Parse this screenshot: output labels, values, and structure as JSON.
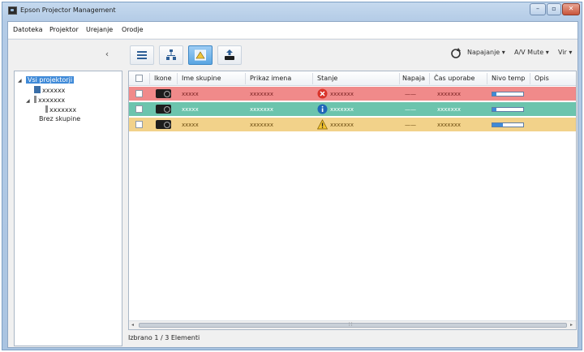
{
  "window": {
    "title": "Epson Projector Management"
  },
  "window_buttons": {
    "minimize": "–",
    "maximize": "▫",
    "close": "✕"
  },
  "menu": [
    "Datoteka",
    "Projektor",
    "Urejanje",
    "Orodje"
  ],
  "toolbar": {
    "collapse": "‹",
    "tabs": [
      {
        "icon": "list-view-icon",
        "active": false
      },
      {
        "icon": "network-view-icon",
        "active": false
      },
      {
        "icon": "warning-view-icon",
        "active": true
      },
      {
        "icon": "upload-projector-icon",
        "active": false
      }
    ],
    "refresh_icon": "refresh-icon",
    "power": "Napajanje ▾",
    "av_mute": "A/V Mute ▾",
    "source": "Vir ▾"
  },
  "tree": {
    "root_toggle": "◢",
    "root": "Vsi projektorji",
    "group1": "xxxxxx",
    "group2_toggle": "◢",
    "group2": "xxxxxxx",
    "group2_child": "xxxxxxx",
    "no_group": "Brez skupine"
  },
  "table": {
    "headers": [
      "Ikone",
      "Ime skupine",
      "Prikaz imena",
      "Stanje",
      "Napaja",
      "Čas uporabe",
      "Nivo temp",
      "Opis"
    ],
    "rows": [
      {
        "group": "xxxxx",
        "display": "xxxxxxx",
        "status": "xxxxxxx",
        "status_icon": "error-icon",
        "power": "——",
        "usage": "xxxxxxx",
        "temp_level": 0.12,
        "bg": "#f08a8a",
        "text_color": "#7a2222"
      },
      {
        "group": "xxxxx",
        "display": "xxxxxxx",
        "status": "xxxxxxx",
        "status_icon": "info-icon",
        "power": "——",
        "usage": "xxxxxxx",
        "temp_level": 0.12,
        "bg": "#6cc4ad",
        "text_color": "#ffffff"
      },
      {
        "group": "xxxxx",
        "display": "xxxxxxx",
        "status": "xxxxxxx",
        "status_icon": "warning-icon",
        "power": "——",
        "usage": "xxxxxxx",
        "temp_level": 0.35,
        "bg": "#f2d28a",
        "text_color": "#6a4b10"
      }
    ],
    "scroll_left": "◂",
    "scroll_right": "▸",
    "scroll_grip": "∷"
  },
  "status": {
    "text": "Izbrano 1 / 3 Elementi"
  },
  "colors": {
    "accent": "#3f8ad8",
    "error_row": "#f08a8a",
    "ok_row": "#6cc4ad",
    "warning_row": "#f2d28a"
  }
}
